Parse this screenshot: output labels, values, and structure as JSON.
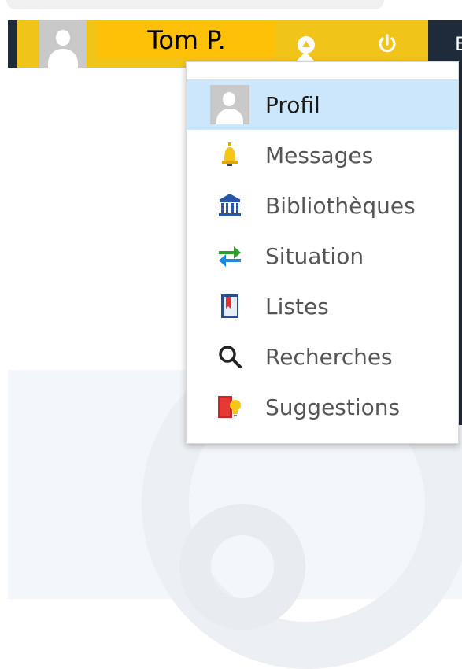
{
  "header": {
    "user_name": "Tom P.",
    "right_letter": "E"
  },
  "menu": {
    "items": [
      {
        "label": "Profil",
        "icon": "avatar-icon",
        "active": true
      },
      {
        "label": "Messages",
        "icon": "bell-icon"
      },
      {
        "label": "Bibliothèques",
        "icon": "library-icon"
      },
      {
        "label": "Situation",
        "icon": "transfer-arrows-icon"
      },
      {
        "label": "Listes",
        "icon": "list-book-icon"
      },
      {
        "label": "Recherches",
        "icon": "search-icon"
      },
      {
        "label": "Suggestions",
        "icon": "suggestion-book-icon"
      }
    ]
  },
  "colors": {
    "header_yellow": "#f0c419",
    "name_highlight": "#ffc107",
    "dark": "#1f2a3a",
    "active_row": "#cce6fb"
  }
}
